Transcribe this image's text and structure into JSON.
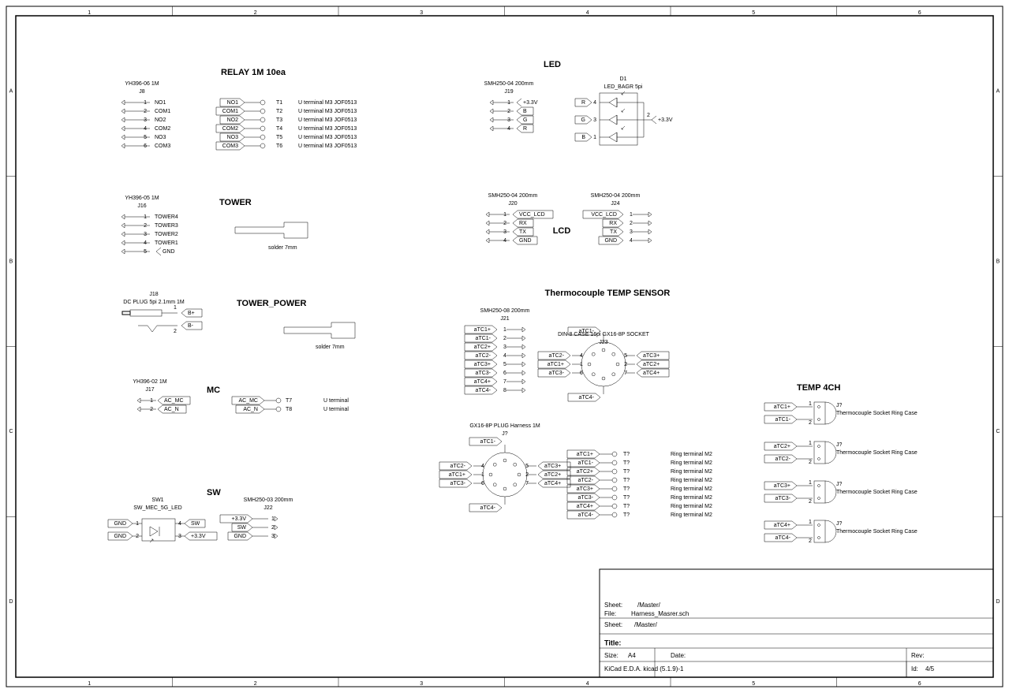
{
  "frame": {
    "cols": [
      "1",
      "2",
      "3",
      "4",
      "5",
      "6"
    ],
    "rows": [
      "A",
      "B",
      "C",
      "D"
    ]
  },
  "titleblock": {
    "sheet_lbl": "Sheet:",
    "sheet_val": "/Master/",
    "file_lbl": "File:",
    "file_val": "Harness_Masrer.sch",
    "title_lbl": "Title:",
    "size_lbl": "Size:",
    "size_val": "A4",
    "date_lbl": "Date:",
    "rev_lbl": "Rev:",
    "gen": "KiCad E.D.A.  kicad (5.1.9)-1",
    "id_lbl": "Id:",
    "id_val": "4/5"
  },
  "J8": {
    "part": "YH396-06 1M",
    "ref": "J8",
    "pins": [
      [
        "1",
        "NO1"
      ],
      [
        "2",
        "COM1"
      ],
      [
        "3",
        "NO2"
      ],
      [
        "4",
        "COM2"
      ],
      [
        "5",
        "NO3"
      ],
      [
        "6",
        "COM3"
      ]
    ]
  },
  "relay": {
    "title": "RELAY 1M 10ea",
    "footprint": "U terminal M3 JOF0513",
    "rows": [
      [
        "NO1",
        "T1"
      ],
      [
        "COM1",
        "T2"
      ],
      [
        "NO2",
        "T3"
      ],
      [
        "COM2",
        "T4"
      ],
      [
        "NO3",
        "T5"
      ],
      [
        "COM3",
        "T6"
      ]
    ]
  },
  "J16": {
    "part": "YH396-05 1M",
    "ref": "J16",
    "pins": [
      [
        "1",
        "TOWER4"
      ],
      [
        "2",
        "TOWER3"
      ],
      [
        "3",
        "TOWER2"
      ],
      [
        "4",
        "TOWER1"
      ],
      [
        "5",
        ""
      ]
    ],
    "gnd": "GND"
  },
  "tower": {
    "title": "TOWER",
    "note": "solder 7mm"
  },
  "J18": {
    "part": "DC PLUG 5pi 2.1mm 1M",
    "ref": "J18",
    "p1": "B+",
    "p2": "B-"
  },
  "tpwr": {
    "title": "TOWER_POWER",
    "note": "solder 7mm"
  },
  "J17": {
    "part": "YH396-02 1M",
    "ref": "J17",
    "p1": "AC_MC",
    "p2": "AC_N"
  },
  "mc": {
    "title": "MC",
    "rows": [
      [
        "AC_MC",
        "T7",
        "U terminal"
      ],
      [
        "AC_N",
        "T8",
        "U terminal"
      ]
    ]
  },
  "sw": {
    "title": "SW"
  },
  "SW1": {
    "part": "SW_MEC_5G_LED",
    "ref": "SW1",
    "lbls": {
      "gnd": "GND",
      "sw": "SW",
      "v33": "+3.3V"
    }
  },
  "J22": {
    "part": "SMH250-03 200mm",
    "ref": "J22",
    "pins": [
      [
        "+3.3V",
        "1"
      ],
      [
        "SW",
        "2"
      ],
      [
        "GND",
        "3"
      ]
    ]
  },
  "led": {
    "title": "LED"
  },
  "J19": {
    "part": "SMH250-04 200mm",
    "ref": "J19",
    "pins": [
      [
        "1",
        "+3.3V"
      ],
      [
        "2",
        "B"
      ],
      [
        "3",
        "G"
      ],
      [
        "4",
        "R"
      ]
    ]
  },
  "D1": {
    "part": "LED_BAGR 5pi",
    "ref": "D1",
    "lbls": {
      "r": "R",
      "g": "G",
      "b": "B",
      "v": "+3.3V",
      "p1": "1",
      "p2": "2",
      "p3": "3",
      "p4": "4"
    }
  },
  "lcd": {
    "title": "LCD"
  },
  "J20": {
    "part": "SMH250-04 200mm",
    "ref": "J20",
    "pins": [
      [
        "1",
        "VCC_LCD"
      ],
      [
        "2",
        "RX"
      ],
      [
        "3",
        "TX"
      ],
      [
        "4",
        "GND"
      ]
    ]
  },
  "J24": {
    "part": "SMH250-04 200mm",
    "ref": "J24",
    "pins": [
      [
        "VCC_LCD",
        "1"
      ],
      [
        "RX",
        "2"
      ],
      [
        "TX",
        "3"
      ],
      [
        "GND",
        "4"
      ]
    ]
  },
  "J21": {
    "part": "SMH250-08 200mm",
    "ref": "J21",
    "pins": [
      [
        "aTC1+",
        "1"
      ],
      [
        "aTC1-",
        "2"
      ],
      [
        "aTC2+",
        "3"
      ],
      [
        "aTC2-",
        "4"
      ],
      [
        "aTC3+",
        "5"
      ],
      [
        "aTC3-",
        "6"
      ],
      [
        "aTC4+",
        "7"
      ],
      [
        "aTC4-",
        "8"
      ]
    ]
  },
  "J23": {
    "part": "DIN-8 CASE 16pi GX16-8P SOCKET",
    "ref": "J23",
    "top": "aTC1-",
    "bot": "aTC4-",
    "L": [
      [
        "aTC2-",
        "4"
      ],
      [
        "aTC1+",
        "1"
      ],
      [
        "aTC3-",
        "6"
      ]
    ],
    "R": [
      [
        "5",
        "aTC3+"
      ],
      [
        "2",
        "aTC2+"
      ],
      [
        "7",
        "aTC4+"
      ]
    ]
  },
  "Jq": {
    "part": "GX16-8P PLUG Harness 1M",
    "ref": "J?",
    "top": "aTC1-",
    "bot": "aTC4-",
    "L": [
      [
        "aTC2-",
        "4"
      ],
      [
        "aTC1+",
        "1"
      ],
      [
        "aTC3-",
        "6"
      ]
    ],
    "R": [
      [
        "5",
        "aTC3+"
      ],
      [
        "2",
        "aTC2+"
      ],
      [
        "7",
        "aTC4+"
      ]
    ]
  },
  "tclist": {
    "note": "Ring terminal M2",
    "rows": [
      [
        "aTC1+",
        "T?"
      ],
      [
        "aTC1-",
        "T?"
      ],
      [
        "aTC2+",
        "T?"
      ],
      [
        "aTC2-",
        "T?"
      ],
      [
        "aTC3+",
        "T?"
      ],
      [
        "aTC3-",
        "T?"
      ],
      [
        "aTC4+",
        "T?"
      ],
      [
        "aTC4-",
        "T?"
      ]
    ]
  },
  "temp4": {
    "title": "TEMP 4CH",
    "fp": "Thermocouple Socket Ring Case",
    "ref": "J?",
    "rows": [
      [
        "aTC1+",
        "aTC1-"
      ],
      [
        "aTC2+",
        "aTC2-"
      ],
      [
        "aTC3+",
        "aTC3-"
      ],
      [
        "aTC4+",
        "aTC4-"
      ]
    ]
  },
  "tcsensor": {
    "title": "Thermocouple TEMP SENSOR"
  }
}
